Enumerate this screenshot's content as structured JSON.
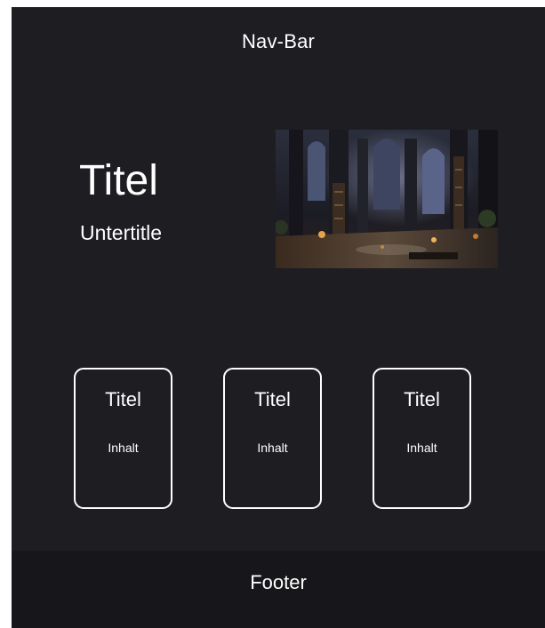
{
  "navbar": {
    "label": "Nav-Bar"
  },
  "hero": {
    "title": "Titel",
    "subtitle": "Untertitle",
    "image_alt": "cathedral-interior-image"
  },
  "cards": [
    {
      "title": "Titel",
      "content": "Inhalt"
    },
    {
      "title": "Titel",
      "content": "Inhalt"
    },
    {
      "title": "Titel",
      "content": "Inhalt"
    }
  ],
  "footer": {
    "label": "Footer"
  },
  "colors": {
    "background": "#1d1d22",
    "footer_background": "#17171b",
    "text": "#ffffff",
    "card_border": "#ffffff"
  }
}
